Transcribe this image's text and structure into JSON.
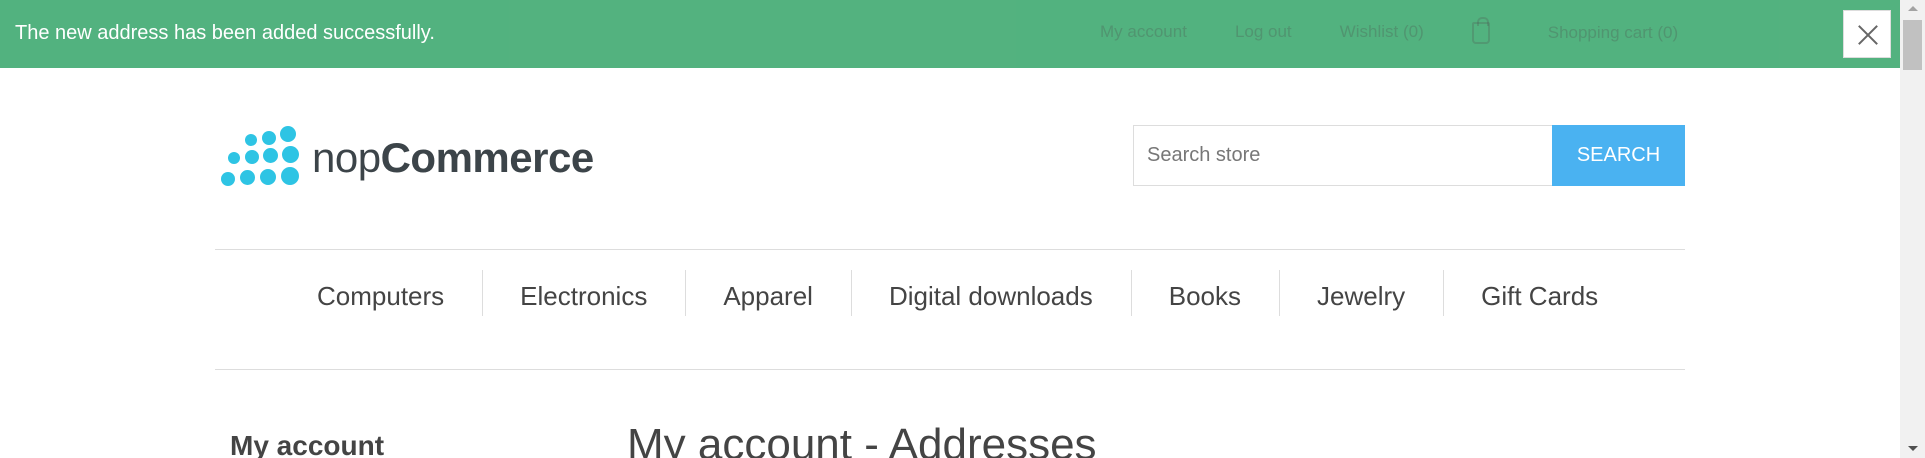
{
  "notification": {
    "message": "The new address has been added successfully.",
    "close_icon": "close-icon"
  },
  "header_links": {
    "my_account": "My account",
    "log_out": "Log out",
    "wishlist": "Wishlist (0)",
    "shopping_cart": "Shopping cart (0)",
    "cart_icon": "shopping-bag-icon"
  },
  "logo": {
    "prefix": "nop",
    "suffix": "Commerce"
  },
  "search": {
    "placeholder": "Search store",
    "button_label": "SEARCH"
  },
  "nav": {
    "items": [
      "Computers",
      "Electronics",
      "Apparel",
      "Digital downloads",
      "Books",
      "Jewelry",
      "Gift Cards"
    ]
  },
  "sidebar": {
    "title": "My account"
  },
  "main": {
    "title": "My account - Addresses"
  },
  "colors": {
    "notification_bg": "#4caf7a",
    "search_button": "#4ab2f1",
    "logo_dots": "#2ec4e4"
  }
}
